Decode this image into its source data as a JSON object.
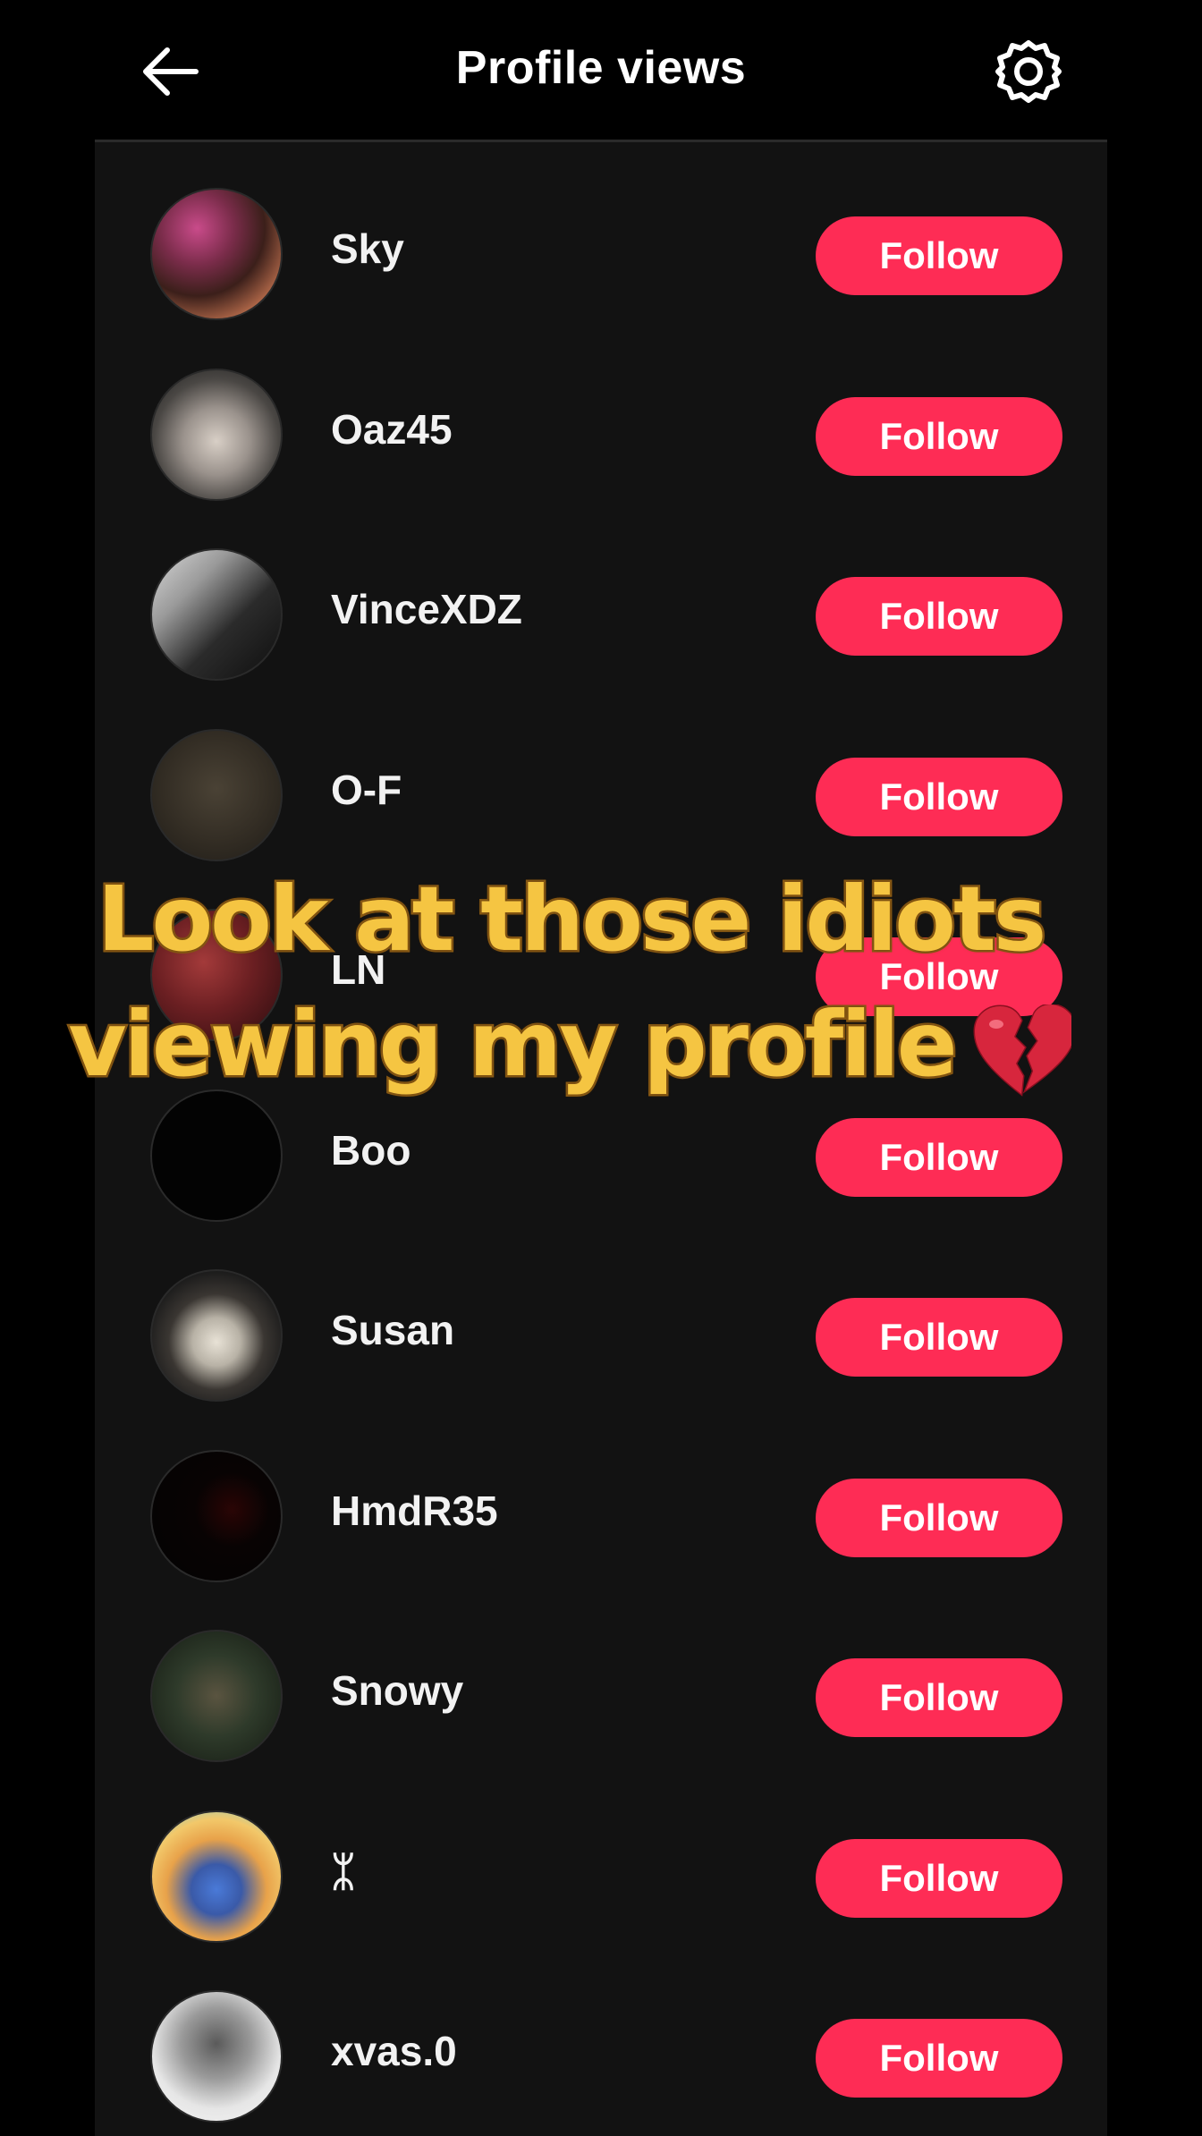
{
  "header": {
    "title": "Profile views",
    "back_icon": "arrow-left-icon",
    "settings_icon": "gear-icon"
  },
  "colors": {
    "follow_button": "#fe2c55",
    "panel_background": "#121212",
    "overlay_text": "#f5c542",
    "overlay_outline": "#8a5a14"
  },
  "viewers": [
    {
      "username": "Sky",
      "button": "Follow"
    },
    {
      "username": "Oaz45",
      "button": "Follow"
    },
    {
      "username": "VinceXDZ",
      "button": "Follow"
    },
    {
      "username": "O-F",
      "button": "Follow"
    },
    {
      "username": "LN",
      "button": "Follow"
    },
    {
      "username": "Boo",
      "button": "Follow"
    },
    {
      "username": "Susan",
      "button": "Follow"
    },
    {
      "username": "HmdR35",
      "button": "Follow"
    },
    {
      "username": "Snowy",
      "button": "Follow"
    },
    {
      "username": "ᛯ",
      "button": "Follow"
    },
    {
      "username": "xvas.0",
      "button": "Follow"
    }
  ],
  "overlay": {
    "line1": "Look at those idiots",
    "line2": "viewing my profile",
    "emoji_icon": "broken-heart-icon"
  }
}
